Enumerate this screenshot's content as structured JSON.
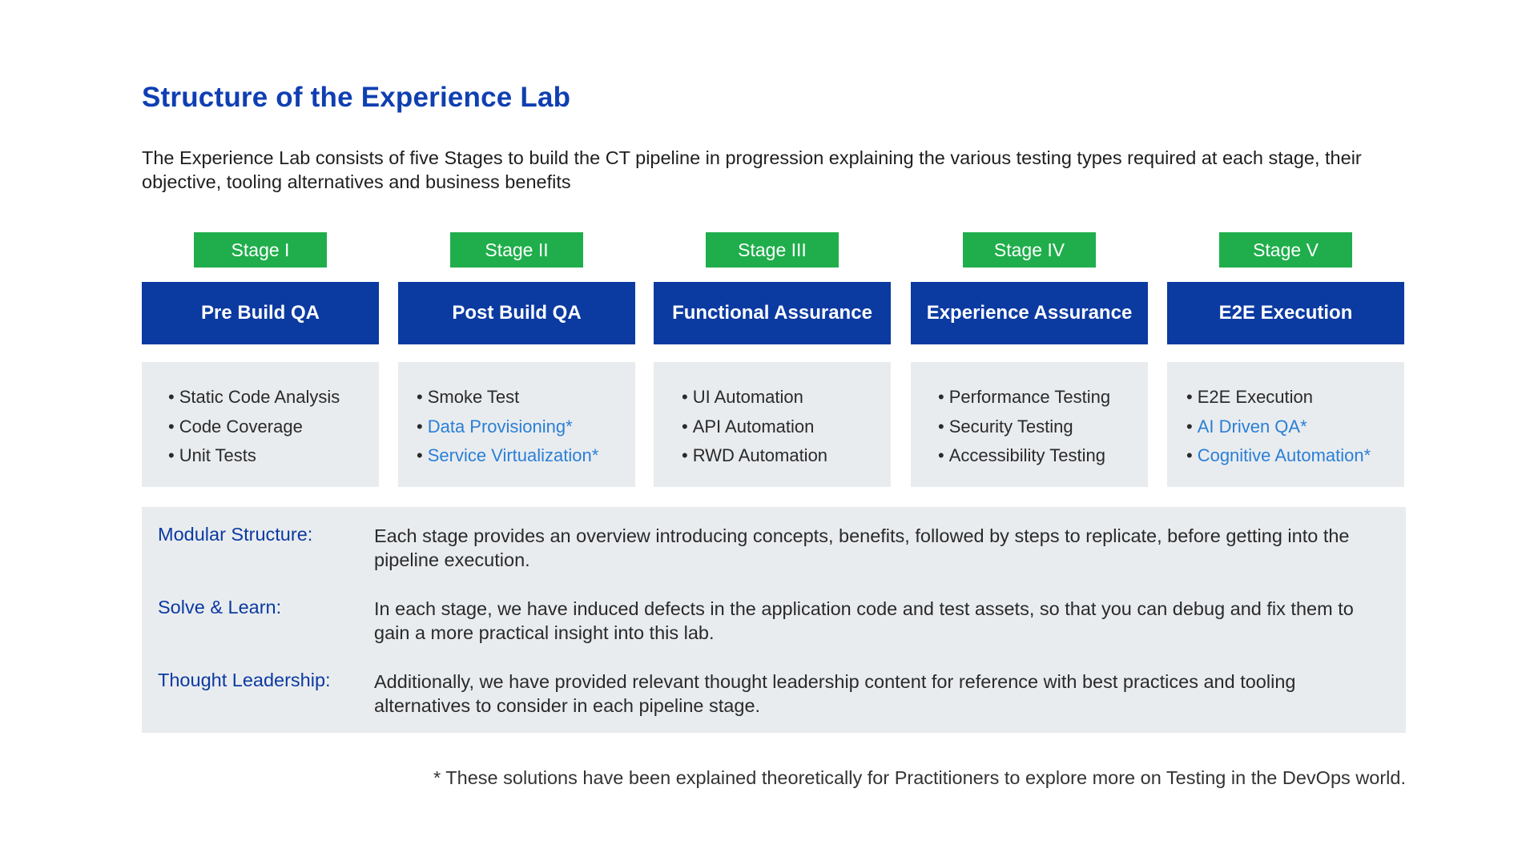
{
  "title": "Structure of the Experience Lab",
  "intro": "The Experience Lab consists of five Stages to build the CT pipeline in progression explaining the various testing types required at each stage, their objective, tooling alternatives and business benefits",
  "stages": [
    {
      "badge": "Stage I",
      "heading": "Pre Build QA",
      "items": [
        {
          "text": "Static Code Analysis",
          "highlight": false
        },
        {
          "text": "Code Coverage",
          "highlight": false
        },
        {
          "text": "Unit Tests",
          "highlight": false
        }
      ]
    },
    {
      "badge": "Stage II",
      "heading": "Post Build QA",
      "items": [
        {
          "text": "Smoke Test",
          "highlight": false
        },
        {
          "text": "Data Provisioning*",
          "highlight": true
        },
        {
          "text": "Service Virtualization*",
          "highlight": true
        }
      ]
    },
    {
      "badge": "Stage III",
      "heading": "Functional Assurance",
      "items": [
        {
          "text": "UI Automation",
          "highlight": false
        },
        {
          "text": "API Automation",
          "highlight": false
        },
        {
          "text": "RWD Automation",
          "highlight": false
        }
      ]
    },
    {
      "badge": "Stage IV",
      "heading": "Experience Assurance",
      "items": [
        {
          "text": "Performance Testing",
          "highlight": false
        },
        {
          "text": "Security Testing",
          "highlight": false
        },
        {
          "text": "Accessibility Testing",
          "highlight": false
        }
      ]
    },
    {
      "badge": "Stage V",
      "heading": "E2E Execution",
      "items": [
        {
          "text": "E2E Execution",
          "highlight": false
        },
        {
          "text": "AI Driven QA*",
          "highlight": true
        },
        {
          "text": "Cognitive Automation*",
          "highlight": true
        }
      ]
    }
  ],
  "info": [
    {
      "label": "Modular Structure:",
      "text": "Each stage provides an overview introducing concepts, benefits, followed by steps to replicate, before getting into the pipeline execution."
    },
    {
      "label": "Solve & Learn:",
      "text": "In each stage, we have induced defects in the application code and test assets, so that you can debug and fix them to gain a more practical insight into this lab."
    },
    {
      "label": "Thought Leadership:",
      "text": "Additionally, we have provided relevant thought leadership content for reference with best practices and tooling alternatives to consider in each pipeline stage."
    }
  ],
  "footnote": "* These solutions have been explained theoretically for Practitioners to explore more on Testing in the DevOps world.",
  "colors": {
    "title_blue": "#0f3fb2",
    "header_blue": "#0b3aa1",
    "badge_green": "#1fae4b",
    "highlight_blue": "#2a7fd6",
    "panel_gray": "#e9ecef"
  }
}
